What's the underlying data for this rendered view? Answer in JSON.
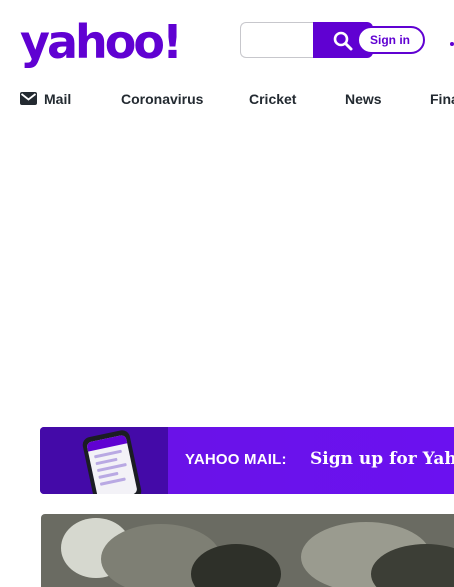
{
  "header": {
    "logo_text": "yahoo!",
    "search": {
      "placeholder": "",
      "value": "",
      "button_icon": "search-icon"
    },
    "signin_label": "Sign in"
  },
  "nav": {
    "items": [
      {
        "label": "Mail",
        "icon": "mail-icon"
      },
      {
        "label": "Coronavirus"
      },
      {
        "label": "Cricket"
      },
      {
        "label": "News"
      },
      {
        "label": "Fina"
      }
    ]
  },
  "promo": {
    "label": "YAHOO MAIL:",
    "cta": "Sign up for Yahoo"
  },
  "colors": {
    "brand": "#6001d2",
    "nav_text": "#232a31",
    "banner_bg": "#6a12e8"
  }
}
